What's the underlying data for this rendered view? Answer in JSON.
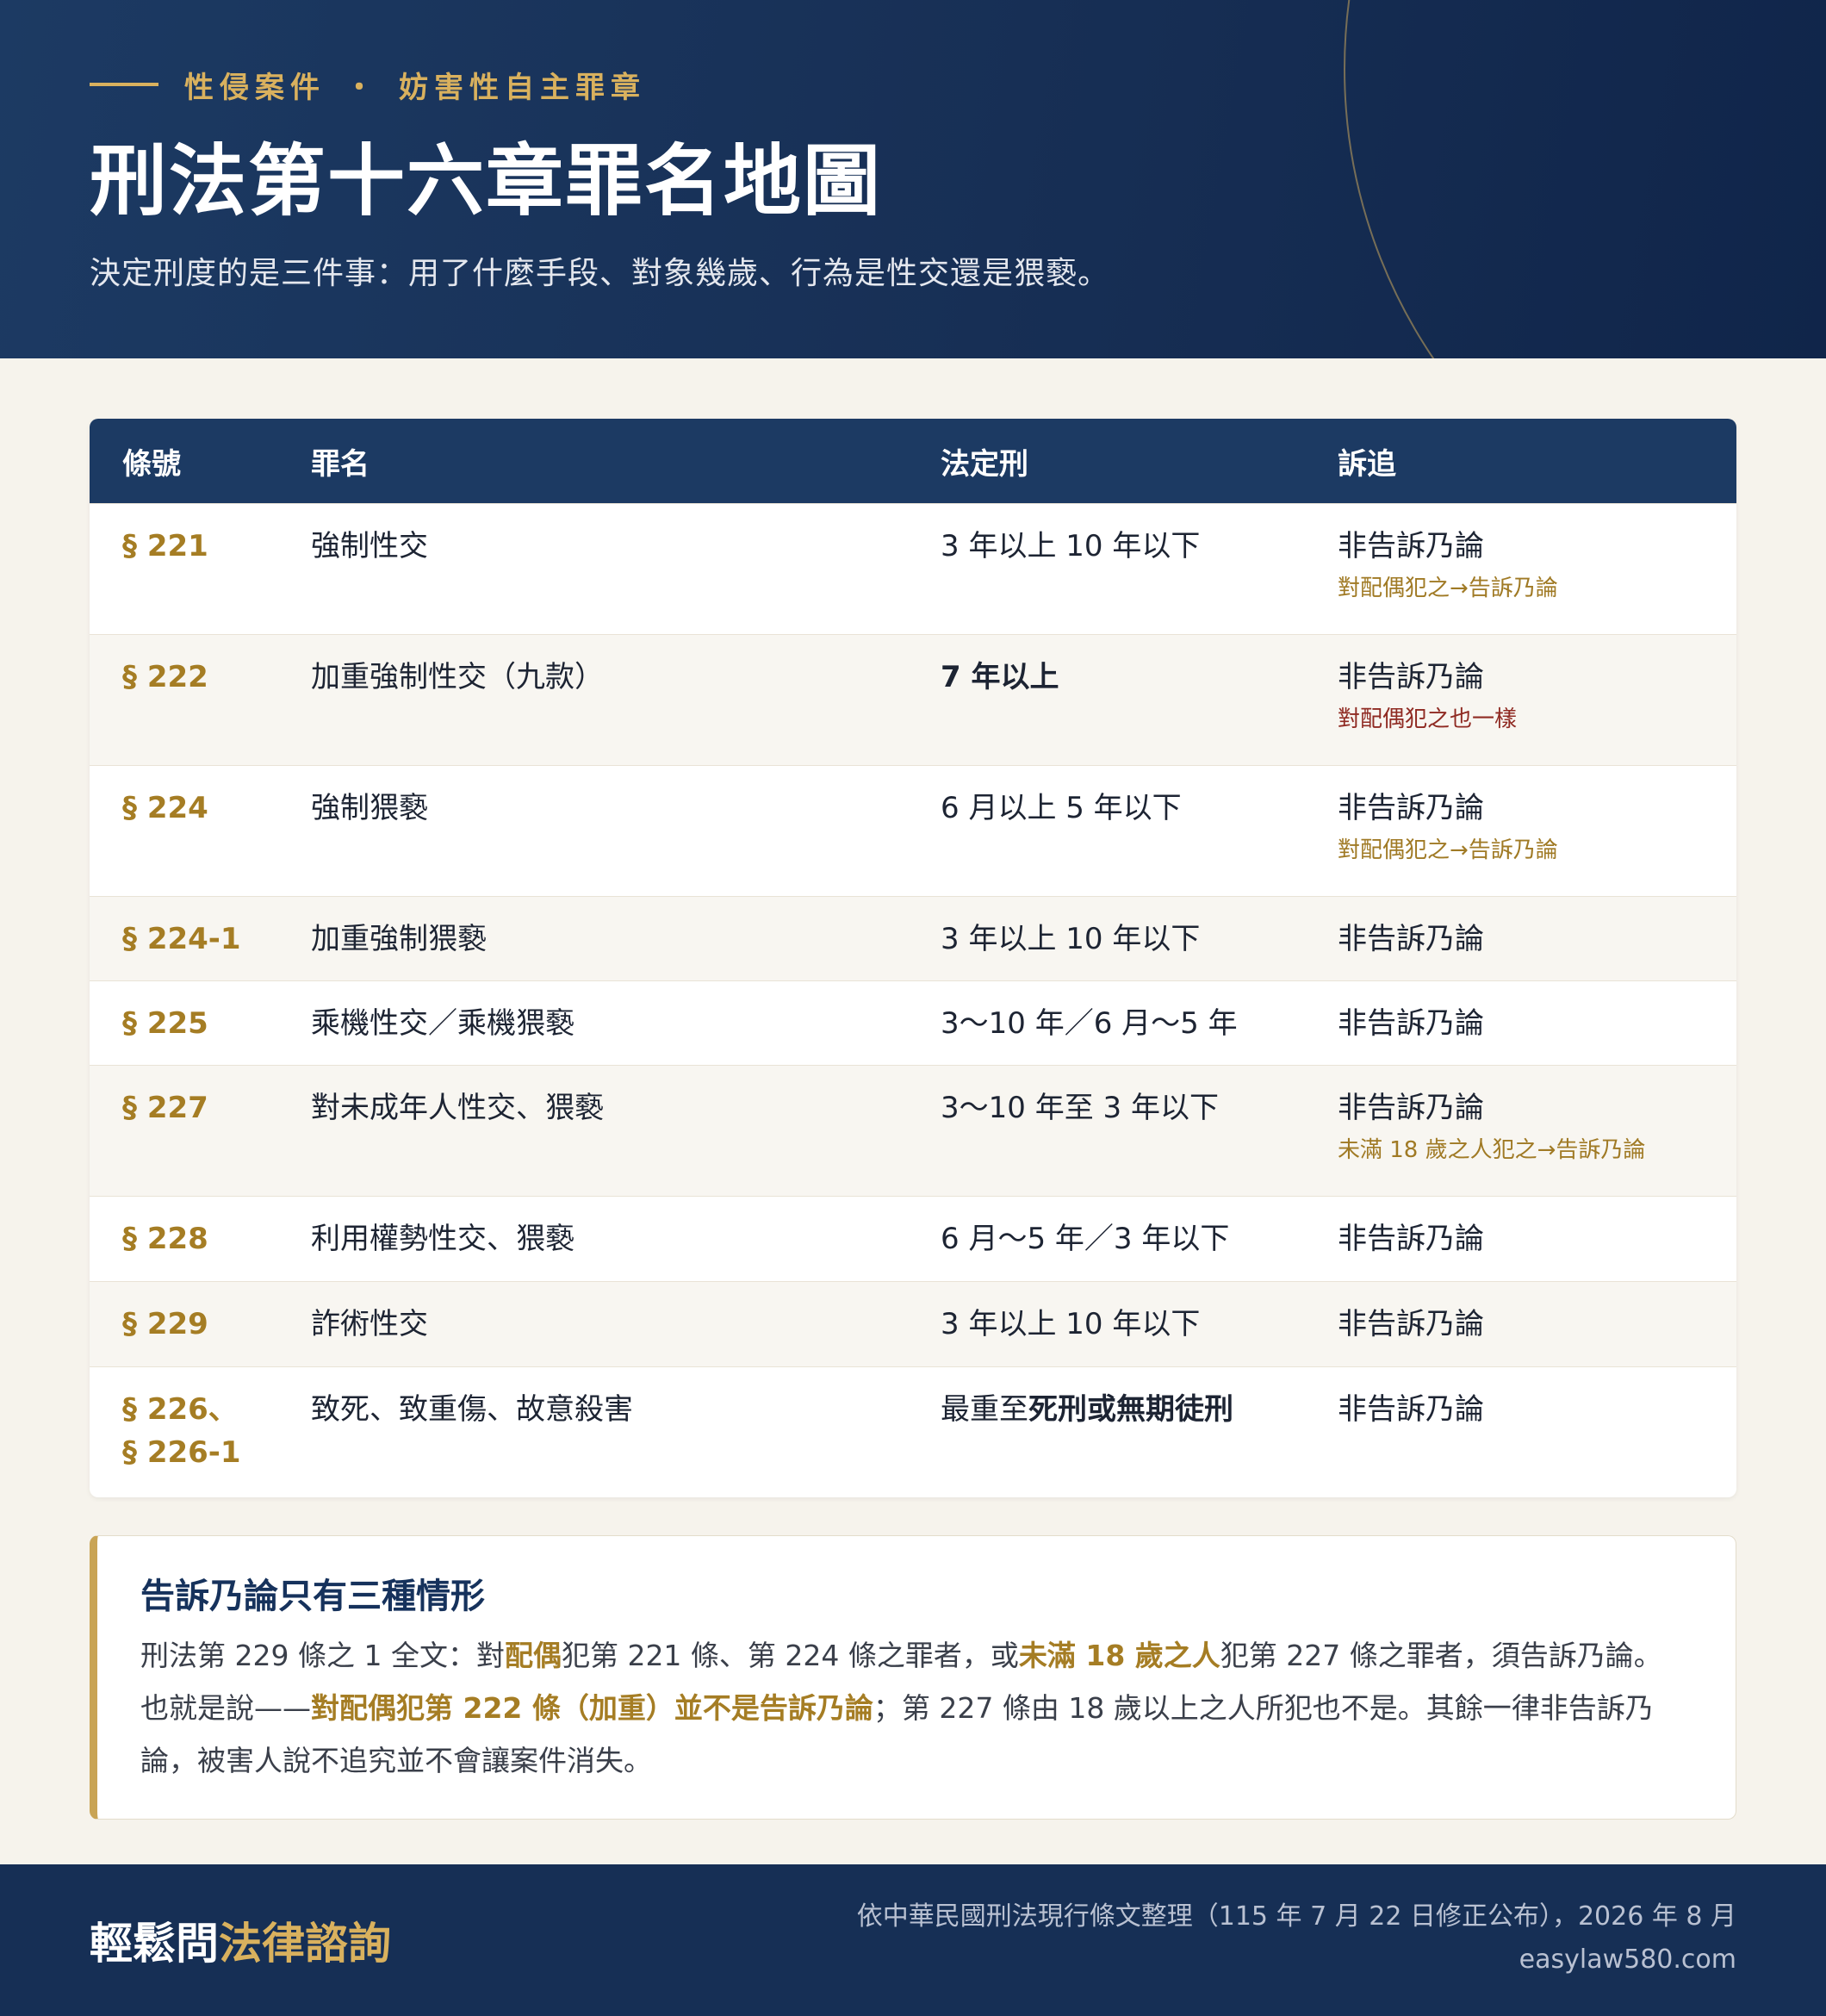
{
  "header": {
    "eyebrow_left": "性侵案件",
    "eyebrow_sep": "・",
    "eyebrow_right": "妨害性自主罪章",
    "title": "刑法第十六章罪名地圖",
    "subtitle": "決定刑度的是三件事：用了什麼手段、對象幾歲、行為是性交還是猥褻。"
  },
  "table": {
    "columns": [
      "條號",
      "罪名",
      "法定刑",
      "訴追"
    ],
    "rows": [
      {
        "article": "§ 221",
        "offense": "強制性交",
        "penalty": "3 年以上 10 年以下",
        "prosecution": "非告訴乃論",
        "note": "對配偶犯之→告訴乃論"
      },
      {
        "article": "§ 222",
        "offense": "加重強制性交（九款）",
        "penalty": "7 年以上",
        "prosecution": "非告訴乃論",
        "note": "對配偶犯之也一樣"
      },
      {
        "article": "§ 224",
        "offense": "強制猥褻",
        "penalty": "6 月以上 5 年以下",
        "prosecution": "非告訴乃論",
        "note": "對配偶犯之→告訴乃論"
      },
      {
        "article": "§ 224-1",
        "offense": "加重強制猥褻",
        "penalty": "3 年以上 10 年以下",
        "prosecution": "非告訴乃論"
      },
      {
        "article": "§ 225",
        "offense": "乘機性交／乘機猥褻",
        "penalty": "3～10 年／6 月～5 年",
        "prosecution": "非告訴乃論"
      },
      {
        "article": "§ 227",
        "offense": "對未成年人性交、猥褻",
        "penalty": "3～10 年至 3 年以下",
        "prosecution": "非告訴乃論",
        "note": "未滿 18 歲之人犯之→告訴乃論"
      },
      {
        "article": "§ 228",
        "offense": "利用權勢性交、猥褻",
        "penalty": "6 月～5 年／3 年以下",
        "prosecution": "非告訴乃論"
      },
      {
        "article": "§ 229",
        "offense": "詐術性交",
        "penalty": "3 年以上 10 年以下",
        "prosecution": "非告訴乃論"
      },
      {
        "article": "§ 226、",
        "article2": "§ 226-1",
        "offense": "致死、致重傷、故意殺害",
        "penalty_prefix": "最重至",
        "penalty_bold": "死刑或無期徒刑",
        "prosecution": "非告訴乃論"
      }
    ]
  },
  "callout": {
    "title": "告訴乃論只有三種情形",
    "p1_a": "刑法第 229 條之 1 全文：對",
    "p1_b": "配偶",
    "p1_c": "犯第 221 條、第 224 條之罪者，或",
    "p1_d": "未滿 18 歲之人",
    "p1_e": "犯第 227 條之罪者，須告訴乃論。",
    "p2_a": "也就是說——",
    "p2_b": "對配偶犯第 222 條（加重）並不是告訴乃論",
    "p2_c": "；第 227 條由 18 歲以上之人所犯也不是。其餘一律非告訴乃論，被害人說不追究並不會讓案件消失。"
  },
  "footer": {
    "brand_a": "輕鬆問",
    "brand_b": "法律諮詢",
    "source": "依中華民國刑法現行條文整理（115 年 7 月 22 日修正公布），2026 年 8 月",
    "site": "easylaw580.com"
  }
}
